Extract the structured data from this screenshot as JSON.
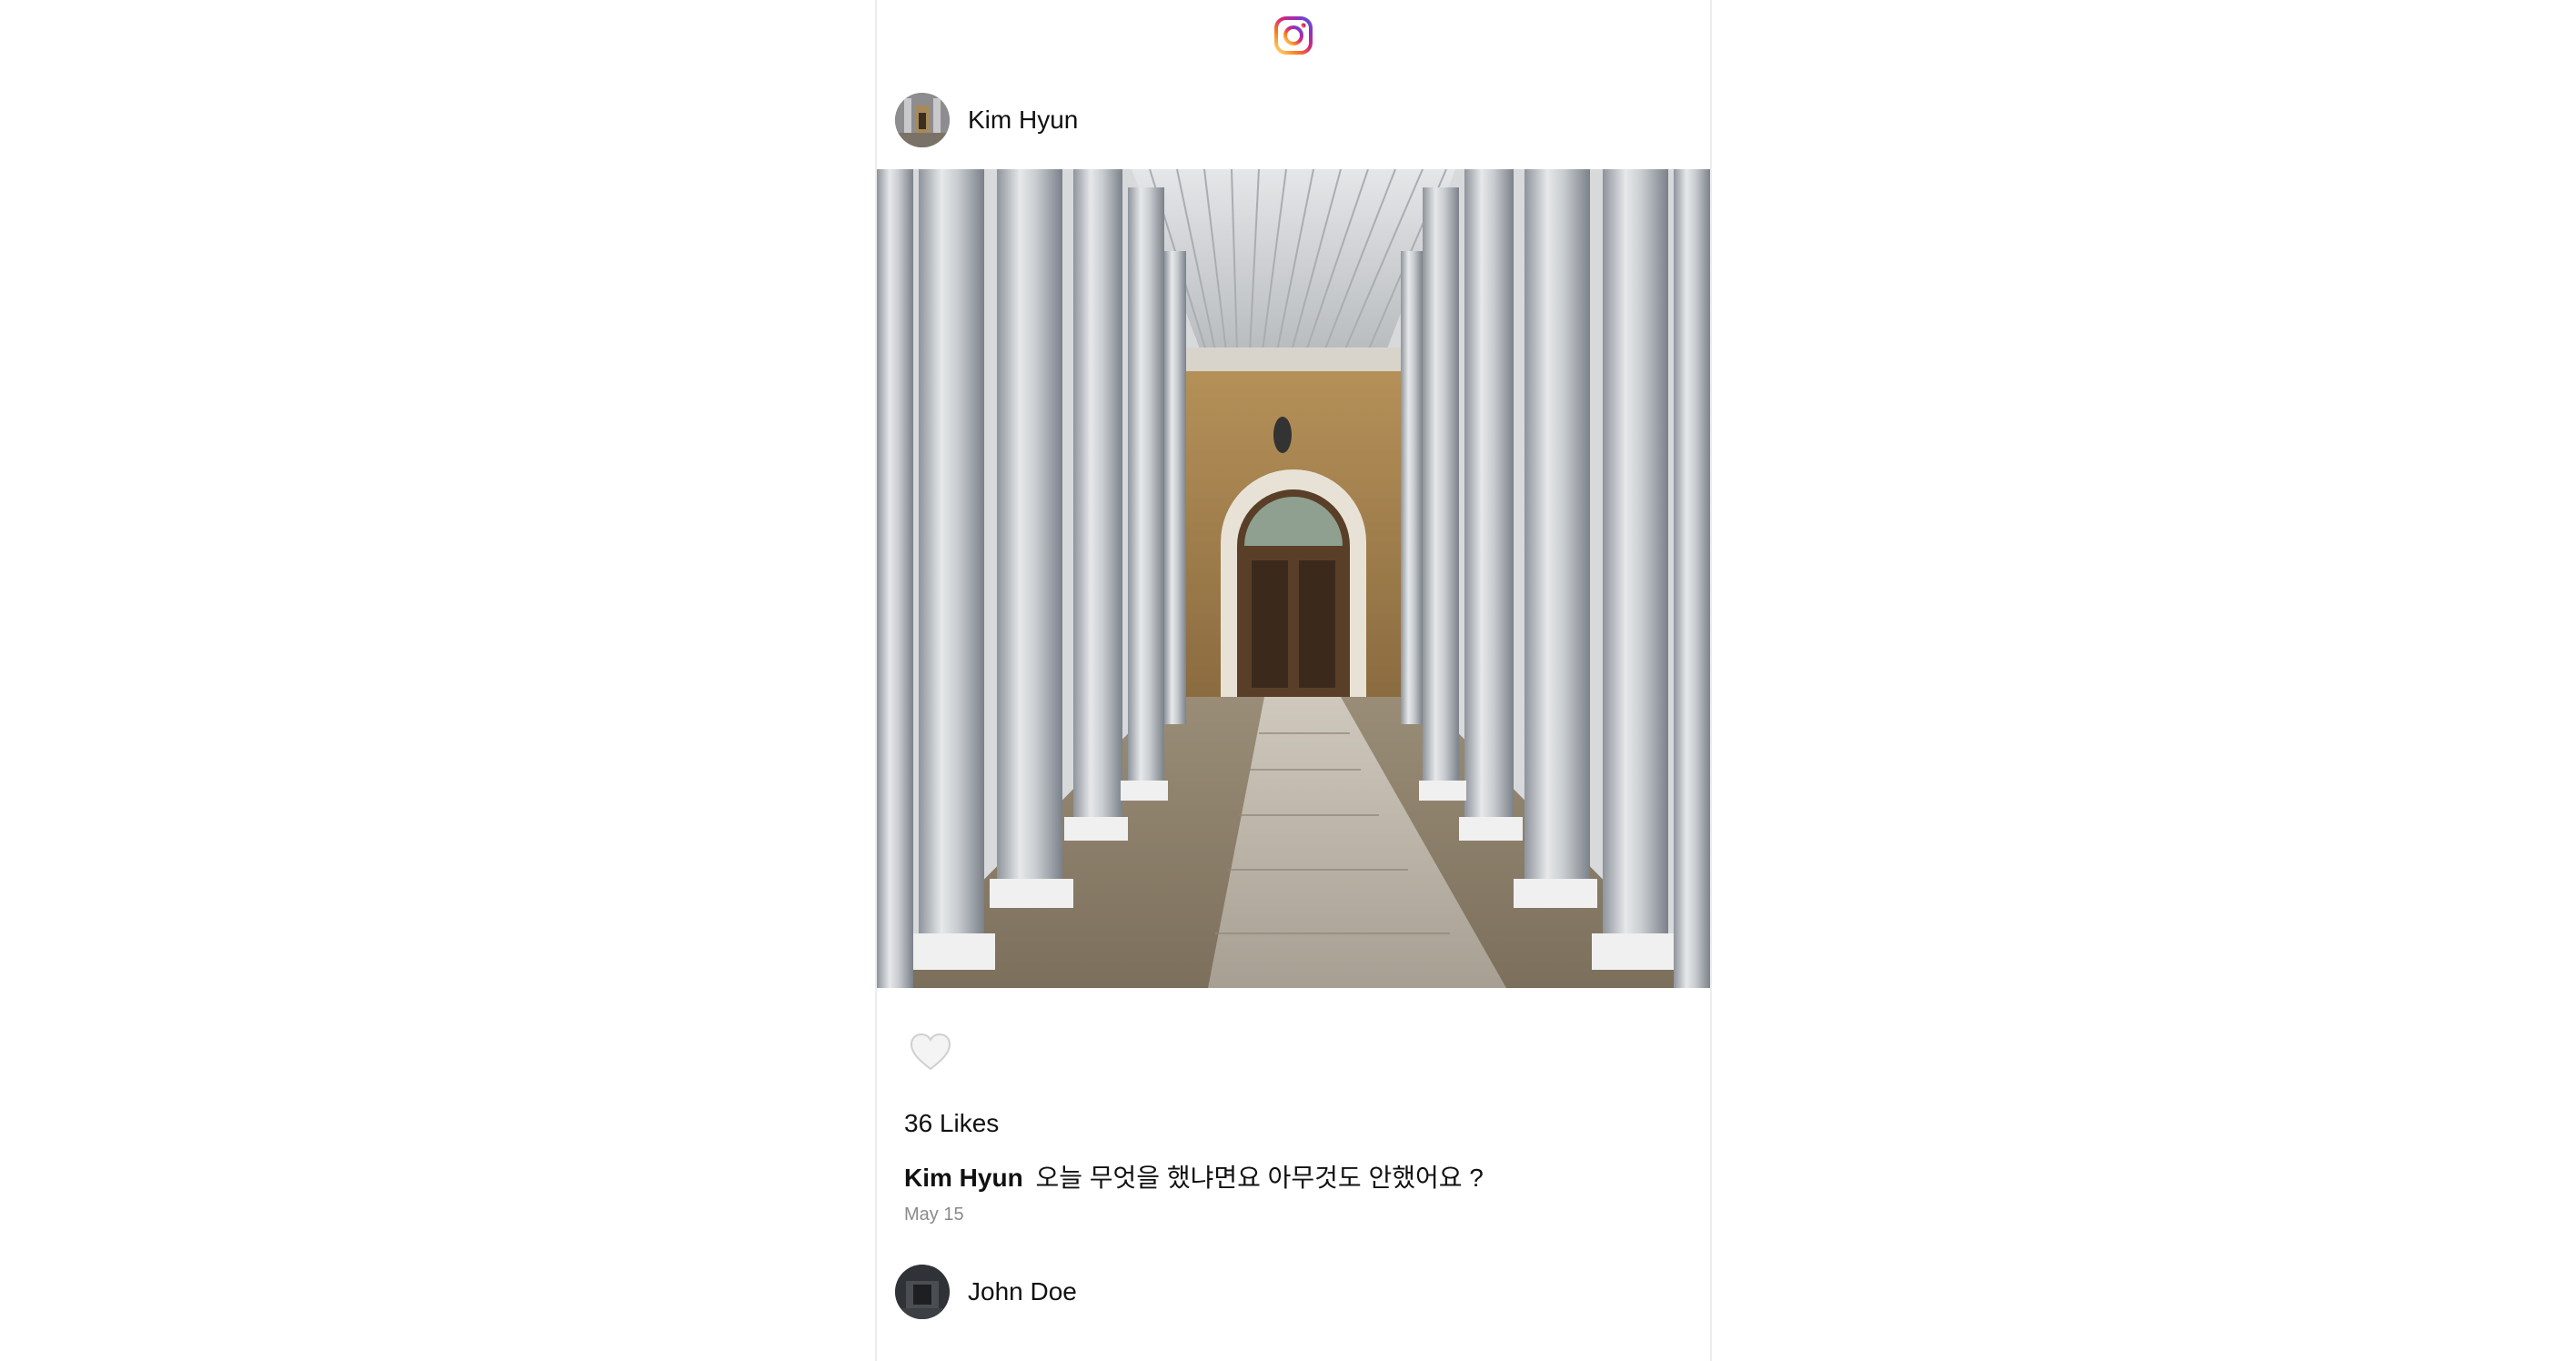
{
  "app": {
    "logo_icon": "instagram-logo-icon",
    "logo_gradient": [
      "#feda75",
      "#fa7e1e",
      "#d62976",
      "#962fbf",
      "#4f5bd5"
    ]
  },
  "posts": [
    {
      "author": "Kim Hyun",
      "avatar_icon": "user-avatar-icon",
      "image_icon": "colonnade-photo",
      "like_icon": "heart-outline-icon",
      "likes_text": "36 Likes",
      "caption_user": "Kim Hyun",
      "caption_text": "오늘 무엇을 했냐면요 아무것도 안했어요 ?",
      "date": "May 15"
    },
    {
      "author": "John Doe",
      "avatar_icon": "user-avatar-icon"
    }
  ]
}
